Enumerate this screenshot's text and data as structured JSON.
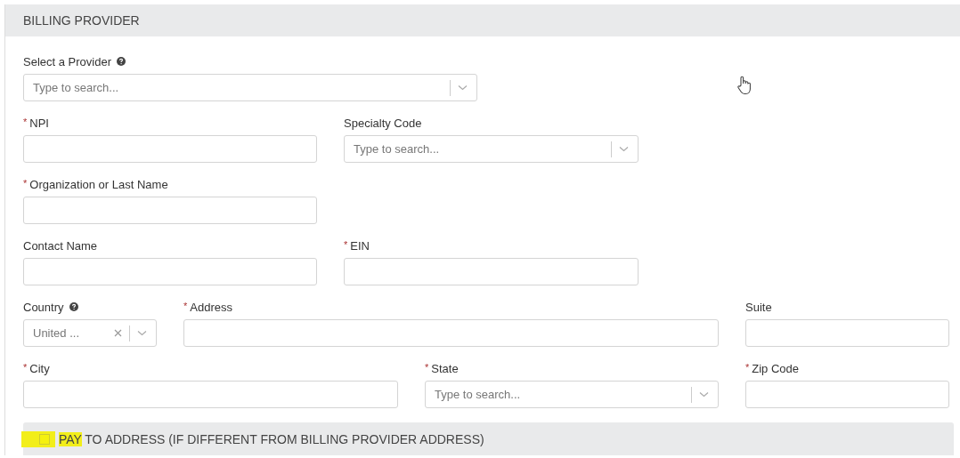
{
  "billing_provider": {
    "title": "BILLING PROVIDER",
    "rows": [
      [
        {
          "kind": "select",
          "label": "Select a Provider",
          "help": true,
          "placeholder": "Type to search..."
        }
      ],
      [
        {
          "kind": "text",
          "required_marker": "*",
          "label": "NPI"
        },
        {
          "kind": "select",
          "label": "Specialty Code",
          "placeholder": "Type to search..."
        }
      ],
      [
        {
          "kind": "text",
          "required_marker": "*",
          "label": "Organization or Last Name"
        }
      ],
      [
        {
          "kind": "text",
          "label": "Contact Name"
        },
        {
          "kind": "text",
          "required_marker": "*",
          "label": "EIN"
        }
      ],
      [
        {
          "kind": "select",
          "label": "Country",
          "help": true,
          "value": "United ...",
          "clearable": true
        },
        {
          "kind": "text",
          "required_marker": "*",
          "label": "Address"
        },
        {
          "kind": "text",
          "label": "Suite"
        }
      ],
      [
        {
          "kind": "text",
          "required_marker": "*",
          "label": "City"
        },
        {
          "kind": "select",
          "required_marker": "*",
          "label": "State",
          "placeholder": "Type to search..."
        },
        {
          "kind": "text",
          "required_marker": "*",
          "label": "Zip Code"
        }
      ]
    ]
  },
  "pay_to_section": {
    "checked": false,
    "highlighted": true,
    "title_highlighted": "PAY",
    "title_rest": "TO ADDRESS (IF DIFFERENT FROM BILLING PROVIDER ADDRESS)"
  }
}
